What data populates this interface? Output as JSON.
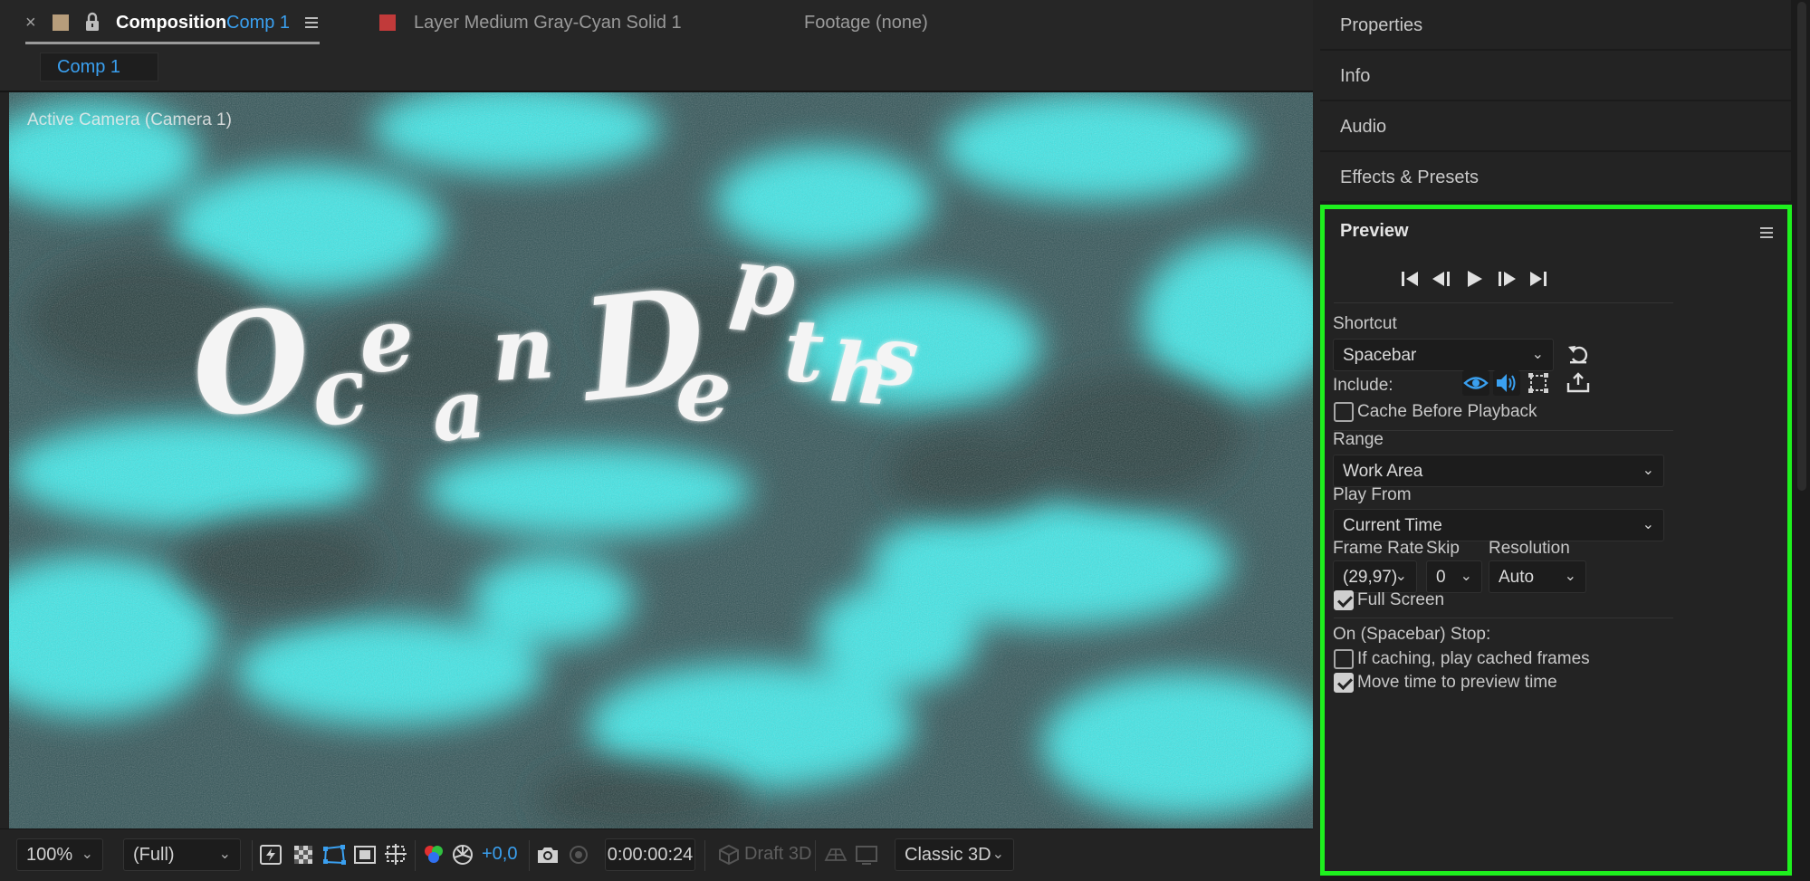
{
  "composition_panel": {
    "tab_title": "Composition",
    "comp_name": "Comp 1",
    "layer_tab": "Layer Medium Gray-Cyan Solid 1",
    "footage_tab": "Footage (none)",
    "sub_tab": "Comp 1",
    "camera_label": "Active Camera (Camera 1)",
    "title_text_letters": [
      "O",
      "c",
      "e",
      "a",
      "n",
      "D",
      "e",
      "p",
      "t",
      "h",
      "s"
    ]
  },
  "toolbar": {
    "zoom": "100%",
    "resolution": "(Full)",
    "exposure": "+0,0",
    "timecode": "0:00:00:24",
    "draft_3d": "Draft 3D",
    "renderer": "Classic 3D"
  },
  "side_panels": {
    "properties": "Properties",
    "info": "Info",
    "audio": "Audio",
    "effects_presets": "Effects & Presets"
  },
  "preview": {
    "title": "Preview",
    "shortcut_label": "Shortcut",
    "shortcut_value": "Spacebar",
    "include_label": "Include:",
    "cache_before_playback": "Cache Before Playback",
    "cache_before_playback_checked": false,
    "range_label": "Range",
    "range_value": "Work Area",
    "play_from_label": "Play From",
    "play_from_value": "Current Time",
    "frame_rate_label": "Frame Rate",
    "frame_rate_value": "(29,97)",
    "skip_label": "Skip",
    "skip_value": "0",
    "resolution_label": "Resolution",
    "resolution_value": "Auto",
    "full_screen": "Full Screen",
    "full_screen_checked": true,
    "stop_label": "On (Spacebar) Stop:",
    "if_caching": "If caching, play cached frames",
    "if_caching_checked": false,
    "move_time": "Move time to preview time",
    "move_time_checked": true
  },
  "colors": {
    "accent_blue": "#3aa0f0",
    "highlight_green": "#1ef01e",
    "viewer_cyan": "#3de8e8",
    "viewer_dark": "#2f4a4c"
  }
}
